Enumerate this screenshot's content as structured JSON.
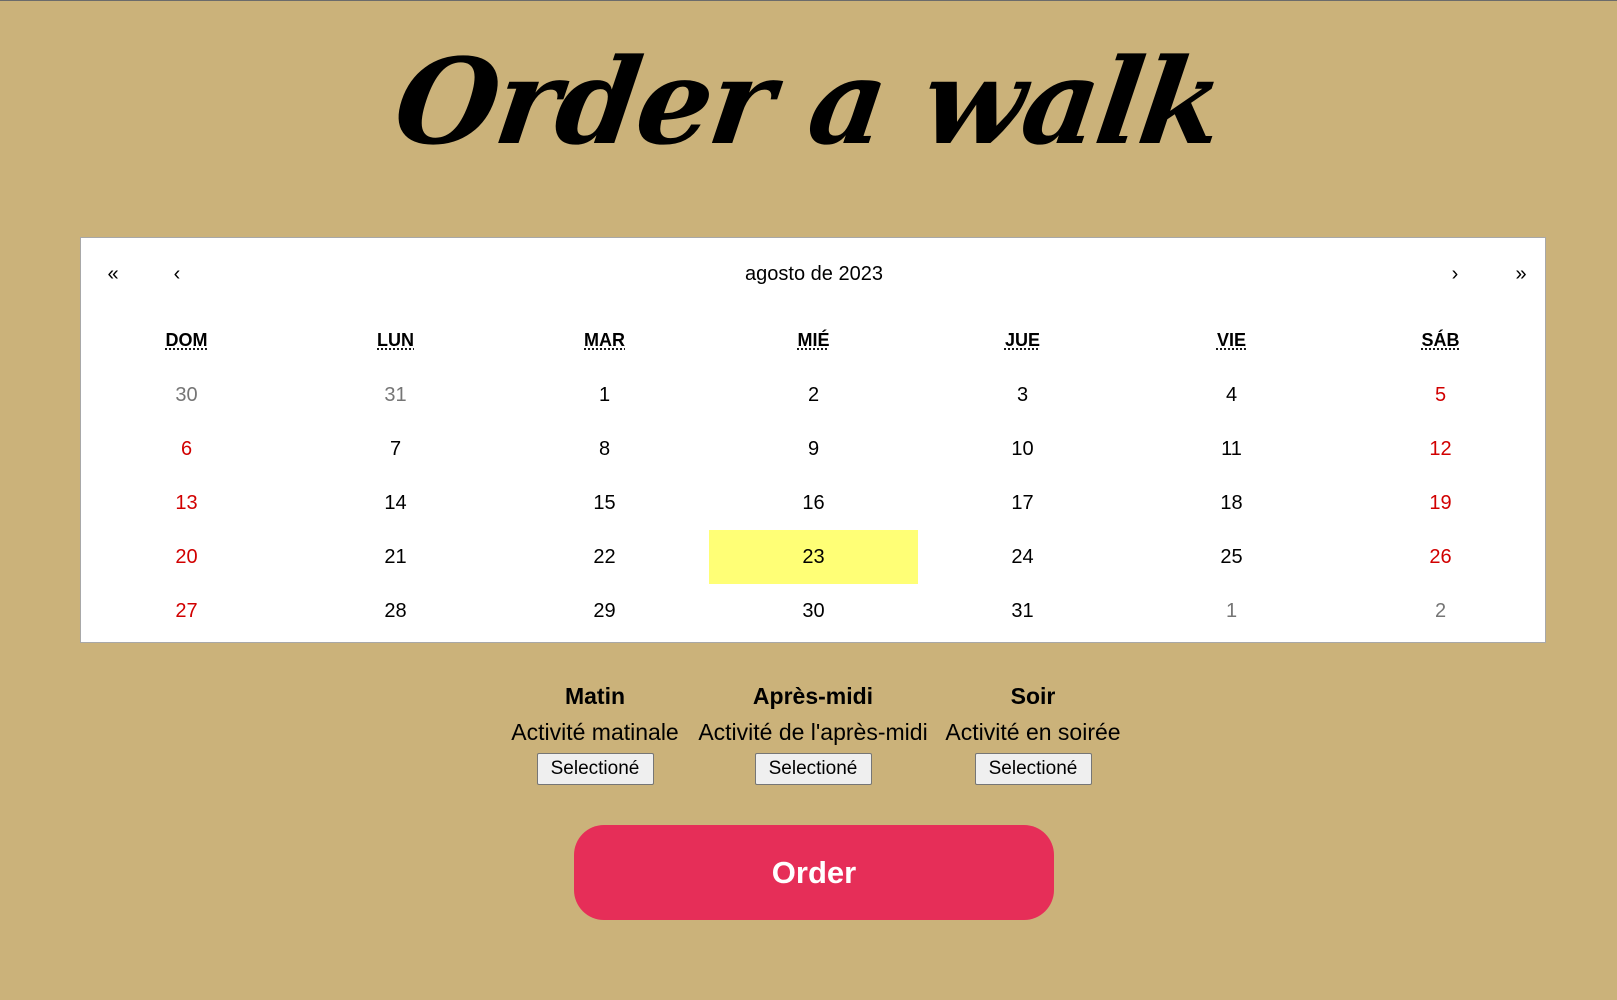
{
  "page": {
    "title": "Order a walk",
    "background_color": "#cbb27a"
  },
  "calendar": {
    "nav": {
      "prev_year": "«",
      "prev_month": "‹",
      "label": "agosto de 2023",
      "next_month": "›",
      "next_year": "»"
    },
    "weekdays": [
      "DOM",
      "LUN",
      "MAR",
      "MIÉ",
      "JUE",
      "VIE",
      "SÁB"
    ],
    "weeks": [
      [
        "30",
        "31",
        "1",
        "2",
        "3",
        "4",
        "5"
      ],
      [
        "6",
        "7",
        "8",
        "9",
        "10",
        "11",
        "12"
      ],
      [
        "13",
        "14",
        "15",
        "16",
        "17",
        "18",
        "19"
      ],
      [
        "20",
        "21",
        "22",
        "23",
        "24",
        "25",
        "26"
      ],
      [
        "27",
        "28",
        "29",
        "30",
        "31",
        "1",
        "2"
      ]
    ],
    "selected_day": "23",
    "weekend_color": "#d10000",
    "outside_month_color": "#757575",
    "selected_color": "#ffff76"
  },
  "slots": [
    {
      "title": "Matin",
      "description": "Activité matinale",
      "button": "Selectioné"
    },
    {
      "title": "Après-midi",
      "description": "Activité de l'après-midi",
      "button": "Selectioné"
    },
    {
      "title": "Soir",
      "description": "Activité en soirée",
      "button": "Selectioné"
    }
  ],
  "order": {
    "label": "Order",
    "color": "#e62e58"
  }
}
